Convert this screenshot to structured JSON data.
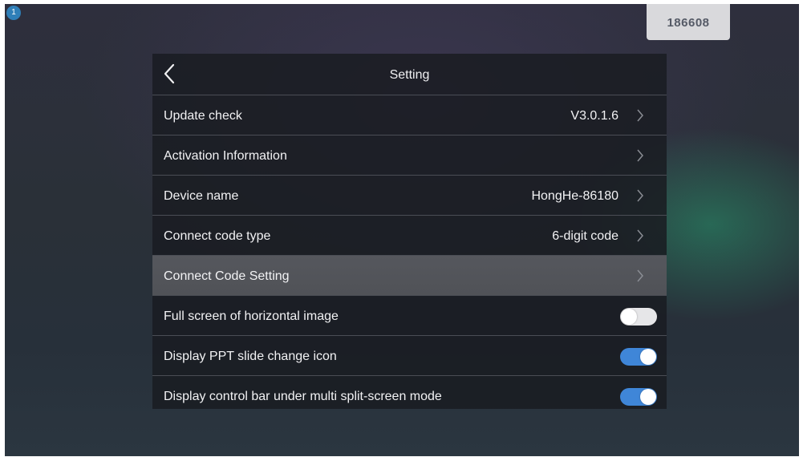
{
  "badge": "1",
  "connect_code": "186608",
  "colors": {
    "toggle_on": "#3f86d8",
    "toggle_off": "#e6e6e8",
    "highlight_row": "#55575d"
  },
  "header": {
    "back_icon": "chevron-left-icon",
    "title": "Setting"
  },
  "rows": [
    {
      "label": "Update check",
      "value": "V3.0.1.6",
      "icon": "chevron-right-icon"
    },
    {
      "label": "Activation Information",
      "value": "",
      "icon": "chevron-right-icon"
    },
    {
      "label": "Device name",
      "value": "HongHe-86180",
      "icon": "chevron-right-icon"
    },
    {
      "label": "Connect code type",
      "value": "6-digit code",
      "icon": "chevron-right-icon"
    },
    {
      "label": "Connect Code Setting",
      "value": "",
      "icon": "chevron-right-icon",
      "highlighted": true
    }
  ],
  "toggles": [
    {
      "label": "Full screen of horizontal image",
      "on": false
    },
    {
      "label": "Display PPT slide change icon",
      "on": true
    },
    {
      "label": "Display control bar under multi split-screen mode",
      "on": true
    }
  ]
}
